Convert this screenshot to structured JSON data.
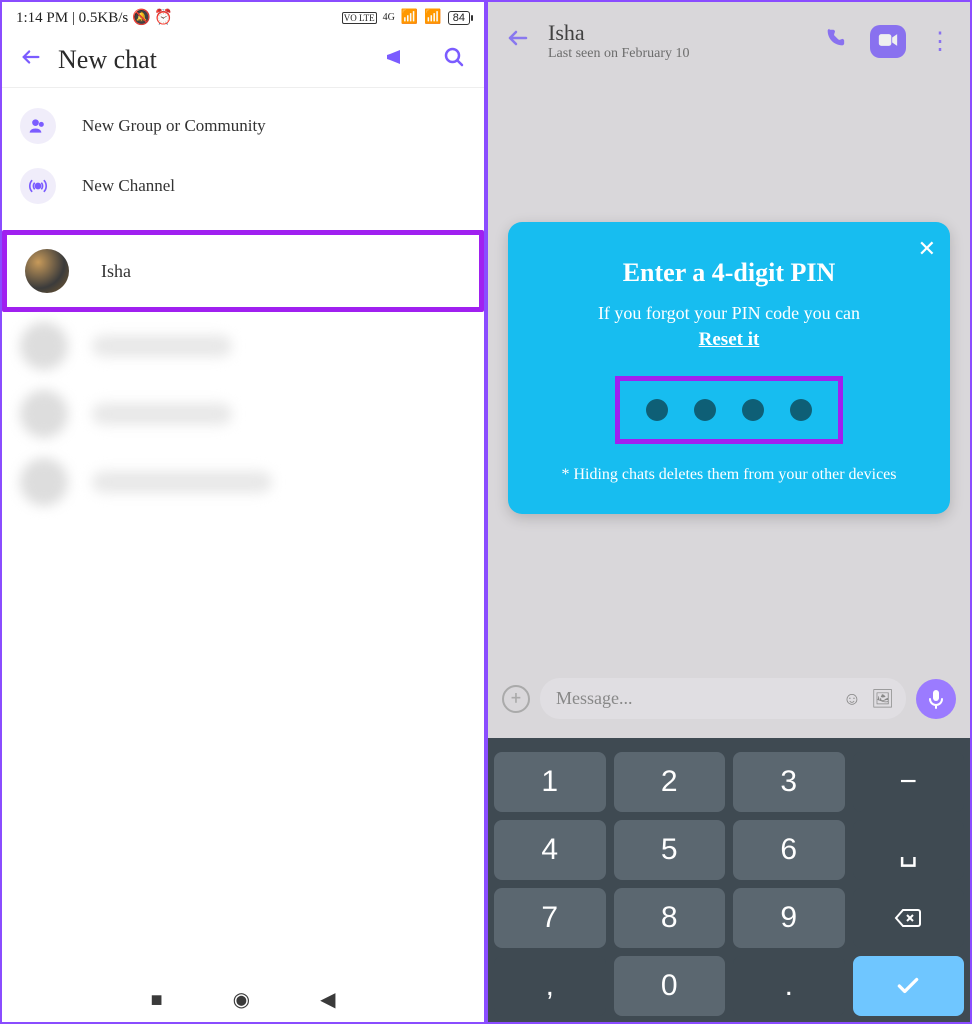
{
  "left": {
    "status": {
      "time": "1:14 PM",
      "speed": "0.5KB/s",
      "net_badge": "VO LTE",
      "net_label": "4G",
      "battery": "84"
    },
    "header": {
      "title": "New chat"
    },
    "menu": {
      "group": "New Group or Community",
      "channel": "New Channel"
    },
    "contact": {
      "name": "Isha"
    }
  },
  "right": {
    "header": {
      "name": "Isha",
      "last_seen": "Last seen on February 10"
    },
    "pin": {
      "title": "Enter a 4-digit PIN",
      "subtitle": "If you forgot your PIN code you can",
      "reset": "Reset it",
      "note": "* Hiding chats deletes them from your other devices"
    },
    "message_input": {
      "placeholder": "Message..."
    },
    "keypad": {
      "keys": [
        "1",
        "2",
        "3",
        "4",
        "5",
        "6",
        "7",
        "8",
        "9",
        "0"
      ],
      "comma": ",",
      "dot": "."
    }
  }
}
